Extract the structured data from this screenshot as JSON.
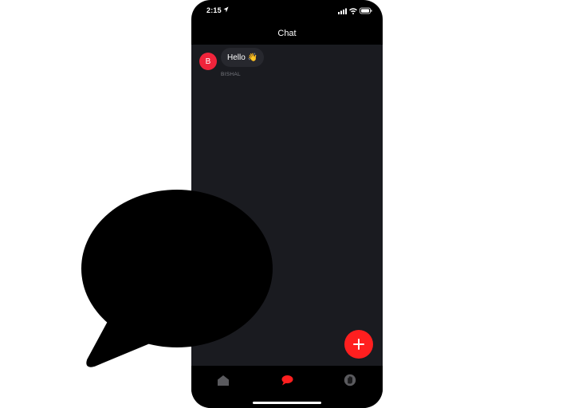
{
  "status_bar": {
    "time": "2:15"
  },
  "header": {
    "title": "Chat"
  },
  "messages": [
    {
      "avatar_initial": "B",
      "text": "Hello 👋",
      "sender": "BISHAL"
    }
  ],
  "fab": {
    "icon": "plus-icon"
  },
  "tabs": [
    {
      "icon": "home-icon",
      "active": false
    },
    {
      "icon": "chat-icon",
      "active": true
    },
    {
      "icon": "hand-icon",
      "active": false
    }
  ],
  "colors": {
    "accent": "#ff1f1f",
    "avatar": "#f0243b",
    "chat_background": "#1a1b20",
    "bubble": "#27282e",
    "inactive_icon": "#5a5a5e"
  },
  "overlay": {
    "icon": "speech-bubble-icon"
  }
}
